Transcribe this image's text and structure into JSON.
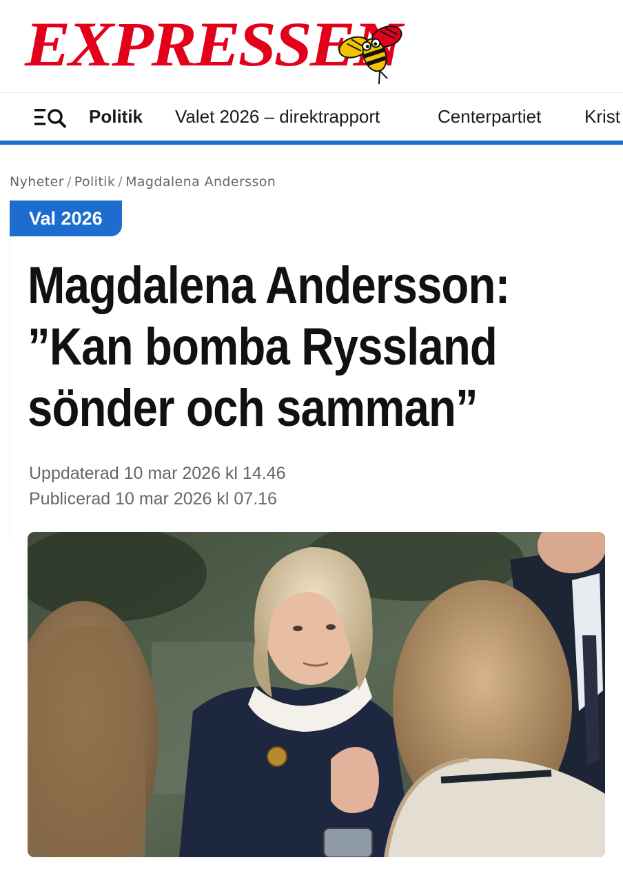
{
  "brand": {
    "name": "EXPRESSEN",
    "accent": "#e3001b",
    "logo_icon": "bee-icon"
  },
  "nav": {
    "menu_icon": "menu-icon",
    "search_icon": "search-icon",
    "items": [
      {
        "label": "Politik",
        "active": true
      },
      {
        "label": "Valet 2026 – direktrapport",
        "active": false
      },
      {
        "label": "Centerpartiet",
        "active": false
      },
      {
        "label": "Krist",
        "active": false
      }
    ],
    "underline_color": "#1d6ccf"
  },
  "breadcrumb": [
    "Nyheter",
    "Politik",
    "Magdalena Andersson"
  ],
  "article": {
    "tag": "Val 2026",
    "headline_lines": [
      "Magdalena Andersson:",
      "”Kan bomba Ryssland",
      "sönder och samman”"
    ],
    "updated": "Uppdaterad 10 mar 2026 kl 14.46",
    "published": "Publicerad 10 mar 2026 kl 07.16"
  }
}
